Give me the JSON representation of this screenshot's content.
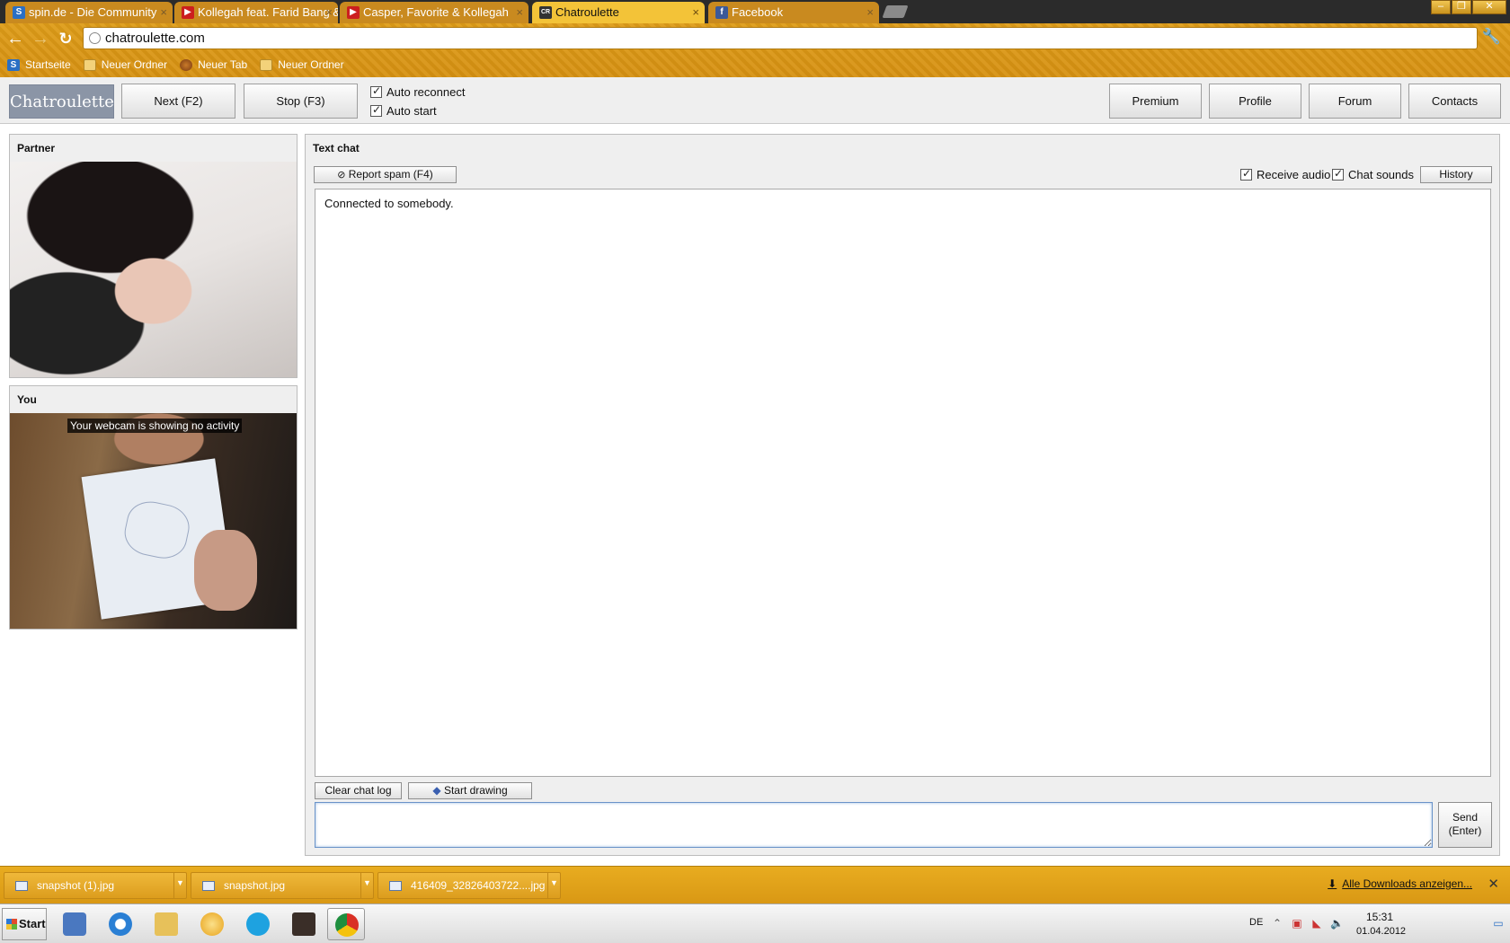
{
  "browser": {
    "tabs": [
      {
        "title": "spin.de - Die Community",
        "favicon": "spin-s-icon",
        "color": "#2a6fc4",
        "glyph": "S"
      },
      {
        "title": "Kollegah feat. Farid Bang &",
        "favicon": "youtube-icon",
        "color": "#cc1f1f",
        "glyph": "▶"
      },
      {
        "title": "Casper, Favorite & Kollegah",
        "favicon": "youtube-icon",
        "color": "#cc1f1f",
        "glyph": "▶"
      },
      {
        "title": "Chatroulette",
        "favicon": "chatroulette-icon",
        "color": "#333333",
        "glyph": "CR"
      },
      {
        "title": "Facebook",
        "favicon": "facebook-icon",
        "color": "#3b5998",
        "glyph": "f"
      }
    ],
    "active_tab": 3,
    "address": "chatroulette.com",
    "bookmarks": [
      {
        "label": "Startseite",
        "icon": "spin-s-icon"
      },
      {
        "label": "Neuer Ordner",
        "icon": "folder-icon"
      },
      {
        "label": "Neuer Tab",
        "icon": "globe-icon"
      },
      {
        "label": "Neuer Ordner",
        "icon": "folder-icon"
      }
    ]
  },
  "site": {
    "logo": "Chatroulette",
    "next_label": "Next (F2)",
    "stop_label": "Stop (F3)",
    "auto_reconnect": "Auto reconnect",
    "auto_start": "Auto start",
    "nav": [
      "Premium",
      "Profile",
      "Forum",
      "Contacts"
    ]
  },
  "partner": {
    "title": "Partner"
  },
  "you": {
    "title": "You",
    "webcam_message": "Your webcam is showing no activity"
  },
  "textchat": {
    "title": "Text chat",
    "report_spam": "Report spam (F4)",
    "receive_audio": "Receive audio",
    "chat_sounds": "Chat sounds",
    "history": "History",
    "log": [
      "Connected to somebody."
    ],
    "clear_log": "Clear chat log",
    "start_drawing": "Start drawing",
    "send_line1": "Send",
    "send_line2": "(Enter)",
    "input_value": ""
  },
  "downloads": {
    "items": [
      "snapshot (1).jpg",
      "snapshot.jpg",
      "416409_32826403722....jpg"
    ],
    "show_all": "Alle Downloads anzeigen..."
  },
  "taskbar": {
    "start": "Start",
    "apps": [
      {
        "name": "media-player-icon",
        "color": "#4a78c0"
      },
      {
        "name": "internet-explorer-icon",
        "color": "#2a7fd4"
      },
      {
        "name": "file-explorer-icon",
        "color": "#e7c15a"
      },
      {
        "name": "winamp-icon",
        "color": "#e8a21a"
      },
      {
        "name": "skype-icon",
        "color": "#1ea2e0"
      },
      {
        "name": "game-icon",
        "color": "#3a2e28"
      },
      {
        "name": "chrome-icon",
        "color": "#d93025"
      }
    ],
    "lang": "DE",
    "time": "15:31",
    "date": "01.04.2012"
  }
}
